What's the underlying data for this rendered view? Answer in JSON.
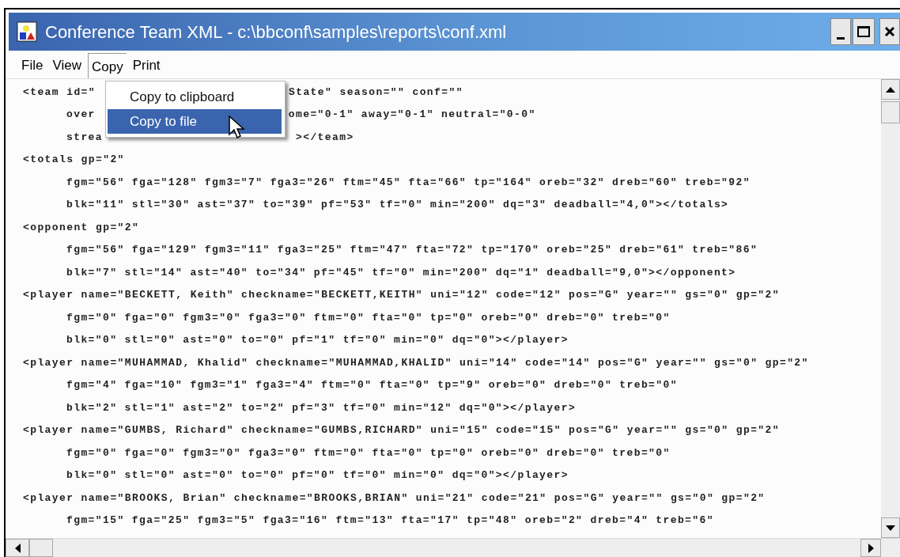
{
  "window": {
    "title": "Conference Team XML - c:\\bbconf\\samples\\reports\\conf.xml"
  },
  "menu_bar": [
    {
      "label": "File",
      "selected": false
    },
    {
      "label": "View",
      "selected": false
    },
    {
      "label": "Copy",
      "selected": true
    },
    {
      "label": "Print",
      "selected": false
    }
  ],
  "dropdown": {
    "items": [
      {
        "label": "Copy to clipboard",
        "selected": false
      },
      {
        "label": "Copy to file",
        "selected": true
      }
    ]
  },
  "lines": [
    {
      "kind": "tag",
      "parts": [
        "<team id=\"",
        "State\" season=\"\" conf=\"\""
      ]
    },
    {
      "kind": "attrs",
      "parts": [
        "over",
        "ome=\"0-1\" away=\"0-1\" neutral=\"0-0\""
      ]
    },
    {
      "kind": "attrs",
      "parts": [
        "strea",
        "></team>"
      ]
    },
    {
      "kind": "tag",
      "parts": [
        "<totals gp=\"2\""
      ]
    },
    {
      "kind": "attrs",
      "parts": [
        "fgm=\"56\" fga=\"128\" fgm3=\"7\" fga3=\"26\" ftm=\"45\" fta=\"66\" tp=\"164\" oreb=\"32\" dreb=\"60\" treb=\"92\""
      ]
    },
    {
      "kind": "attrs",
      "parts": [
        "blk=\"11\" stl=\"30\" ast=\"37\" to=\"39\" pf=\"53\" tf=\"0\" min=\"200\" dq=\"3\" deadball=\"4,0\"></totals>"
      ]
    },
    {
      "kind": "tag",
      "parts": [
        "<opponent gp=\"2\""
      ]
    },
    {
      "kind": "attrs",
      "parts": [
        "fgm=\"56\" fga=\"129\" fgm3=\"11\" fga3=\"25\" ftm=\"47\" fta=\"72\" tp=\"170\" oreb=\"25\" dreb=\"61\" treb=\"86\""
      ]
    },
    {
      "kind": "attrs",
      "parts": [
        "blk=\"7\" stl=\"14\" ast=\"40\" to=\"34\" pf=\"45\" tf=\"0\" min=\"200\" dq=\"1\" deadball=\"9,0\"></opponent>"
      ]
    },
    {
      "kind": "tag",
      "parts": [
        "<player name=\"BECKETT, Keith\" checkname=\"BECKETT,KEITH\" uni=\"12\" code=\"12\" pos=\"G\" year=\"\" gs=\"0\" gp=\"2\""
      ]
    },
    {
      "kind": "attrs",
      "parts": [
        "fgm=\"0\" fga=\"0\" fgm3=\"0\" fga3=\"0\" ftm=\"0\" fta=\"0\" tp=\"0\" oreb=\"0\" dreb=\"0\" treb=\"0\""
      ]
    },
    {
      "kind": "attrs",
      "parts": [
        "blk=\"0\" stl=\"0\" ast=\"0\" to=\"0\" pf=\"1\" tf=\"0\" min=\"0\" dq=\"0\"></player>"
      ]
    },
    {
      "kind": "tag",
      "parts": [
        "<player name=\"MUHAMMAD, Khalid\" checkname=\"MUHAMMAD,KHALID\" uni=\"14\" code=\"14\" pos=\"G\" year=\"\" gs=\"0\" gp=\"2\""
      ]
    },
    {
      "kind": "attrs",
      "parts": [
        "fgm=\"4\" fga=\"10\" fgm3=\"1\" fga3=\"4\" ftm=\"0\" fta=\"0\" tp=\"9\" oreb=\"0\" dreb=\"0\" treb=\"0\""
      ]
    },
    {
      "kind": "attrs",
      "parts": [
        "blk=\"2\" stl=\"1\" ast=\"2\" to=\"2\" pf=\"3\" tf=\"0\" min=\"12\" dq=\"0\"></player>"
      ]
    },
    {
      "kind": "tag",
      "parts": [
        "<player name=\"GUMBS, Richard\" checkname=\"GUMBS,RICHARD\" uni=\"15\" code=\"15\" pos=\"G\" year=\"\" gs=\"0\" gp=\"2\""
      ]
    },
    {
      "kind": "attrs",
      "parts": [
        "fgm=\"0\" fga=\"0\" fgm3=\"0\" fga3=\"0\" ftm=\"0\" fta=\"0\" tp=\"0\" oreb=\"0\" dreb=\"0\" treb=\"0\""
      ]
    },
    {
      "kind": "attrs",
      "parts": [
        "blk=\"0\" stl=\"0\" ast=\"0\" to=\"0\" pf=\"0\" tf=\"0\" min=\"0\" dq=\"0\"></player>"
      ]
    },
    {
      "kind": "tag",
      "parts": [
        "<player name=\"BROOKS, Brian\" checkname=\"BROOKS,BRIAN\" uni=\"21\" code=\"21\" pos=\"G\" year=\"\" gs=\"0\" gp=\"2\""
      ]
    },
    {
      "kind": "attrs",
      "parts": [
        "fgm=\"15\" fga=\"25\" fgm3=\"5\" fga3=\"16\" ftm=\"13\" fta=\"17\" tp=\"48\" oreb=\"2\" dreb=\"4\" treb=\"6\""
      ]
    }
  ]
}
